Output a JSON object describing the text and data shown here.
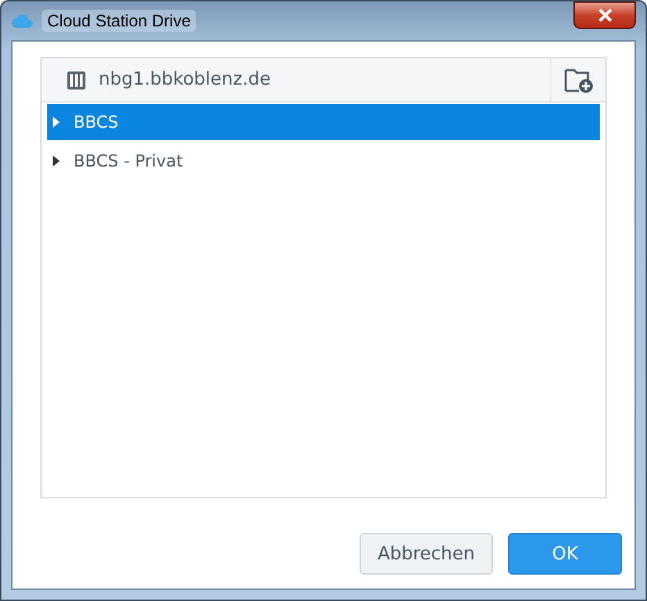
{
  "window": {
    "title": "Cloud Station Drive"
  },
  "server": {
    "name": "nbg1.bbkoblenz.de"
  },
  "tree": [
    {
      "label": "BBCS",
      "selected": true,
      "expanded": false
    },
    {
      "label": "BBCS - Privat",
      "selected": false,
      "expanded": false
    }
  ],
  "buttons": [
    {
      "label": "Abbrechen",
      "kind": "secondary"
    },
    {
      "label": "OK",
      "kind": "primary"
    }
  ]
}
